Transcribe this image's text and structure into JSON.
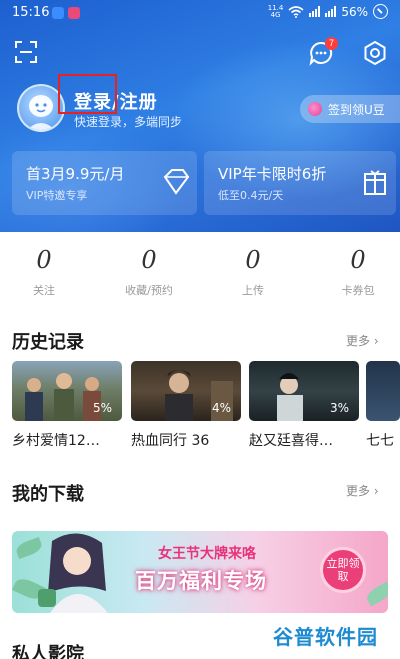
{
  "status_bar": {
    "time": "15:16",
    "network": "4G",
    "battery": "56%"
  },
  "header": {
    "message_badge": "7",
    "login_title": "登录/注册",
    "login_subtitle": "快速登录，多端同步",
    "signin_label": "签到领U豆"
  },
  "vip_cards": [
    {
      "title": "首3月9.9元/月",
      "subtitle": "VIP特邀专享"
    },
    {
      "title": "VIP年卡限时6折",
      "subtitle": "低至0.4元/天"
    }
  ],
  "stats": [
    {
      "value": "0",
      "label": "关注"
    },
    {
      "value": "0",
      "label": "收藏/预约"
    },
    {
      "value": "0",
      "label": "上传"
    },
    {
      "value": "0",
      "label": "卡券包"
    }
  ],
  "history": {
    "title": "历史记录",
    "more": "更多 ›",
    "items": [
      {
        "title": "乡村爱情12…",
        "progress": "5%"
      },
      {
        "title": "热血同行 36",
        "progress": "4%"
      },
      {
        "title": "赵又廷喜得…",
        "progress": "3%"
      },
      {
        "title": "七七",
        "progress": ""
      }
    ]
  },
  "downloads": {
    "title": "我的下载",
    "more": "更多 ›"
  },
  "banner": {
    "line1": "女王节大牌来咯",
    "line2": "百万福利专场",
    "button": "立即领取"
  },
  "next_section": {
    "title": "私人影院"
  },
  "watermark": "谷普软件园",
  "colors": {
    "header_blue": "#2f7fe4",
    "badge_red": "#ff3d3d",
    "highlight_box": "#e8231f"
  }
}
